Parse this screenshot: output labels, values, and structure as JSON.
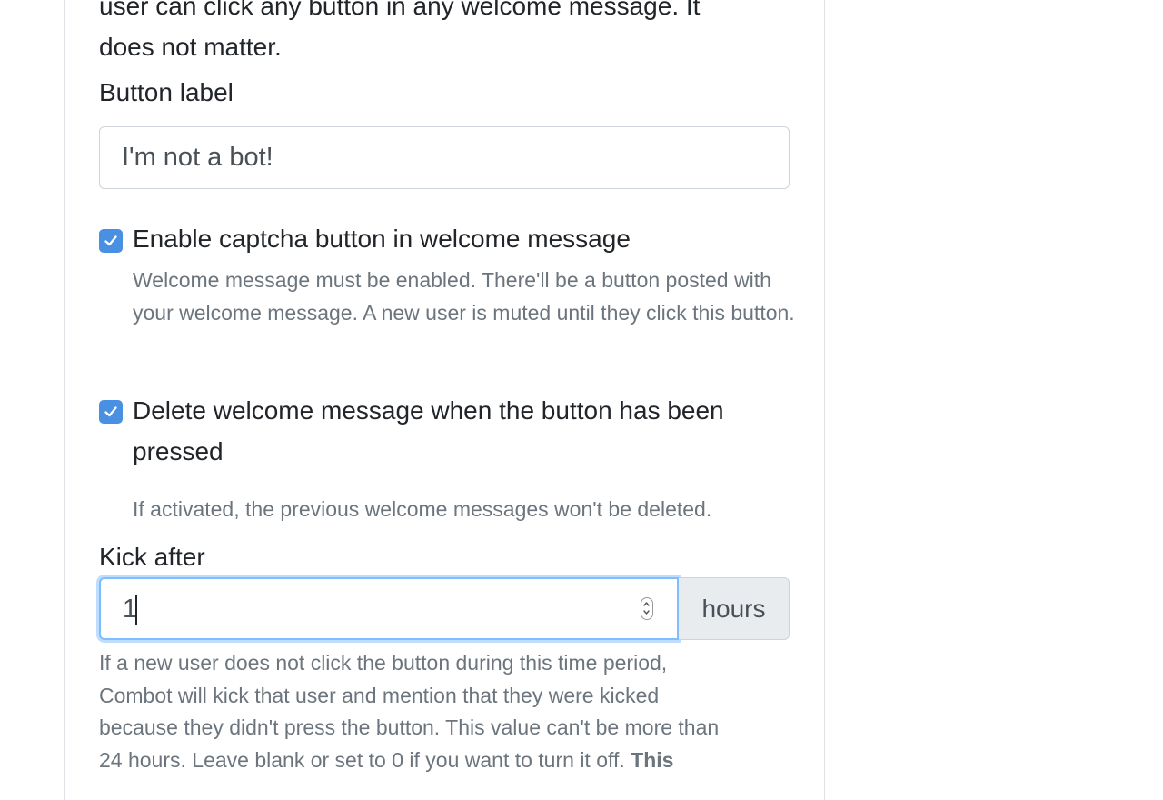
{
  "intro": {
    "line1": "user can click any button in any welcome message. It",
    "line2": "does not matter."
  },
  "button_label": {
    "label": "Button label",
    "value": "I'm not a bot!"
  },
  "captcha": {
    "checked": true,
    "label": "Enable captcha button in welcome message",
    "help": "Welcome message must be enabled. There'll be a button posted with your welcome message. A new user is muted until they click this button."
  },
  "delete_message": {
    "checked": true,
    "label": "Delete welcome message when the button has been pressed",
    "help": "If activated, the previous welcome messages won't be deleted."
  },
  "kick_after": {
    "label": "Kick after",
    "value": "1",
    "unit": "hours",
    "help_line1": "If a new user does not click the button during this time period,",
    "help_line2": "Combot will kick that user and mention that they were kicked",
    "help_line3": "because they didn't press the button. This value can't be more than",
    "help_line4": "24 hours. Leave blank or set to 0 if you want to turn it off.",
    "help_bold": "This"
  },
  "colors": {
    "accent": "#4a90e2",
    "focus_border": "#80bdff",
    "text": "#212529",
    "muted": "#6c757d",
    "addon_bg": "#e9ecef"
  },
  "icons": {
    "checkbox": "check-icon",
    "spinner": "spinner-arrows-icon"
  }
}
